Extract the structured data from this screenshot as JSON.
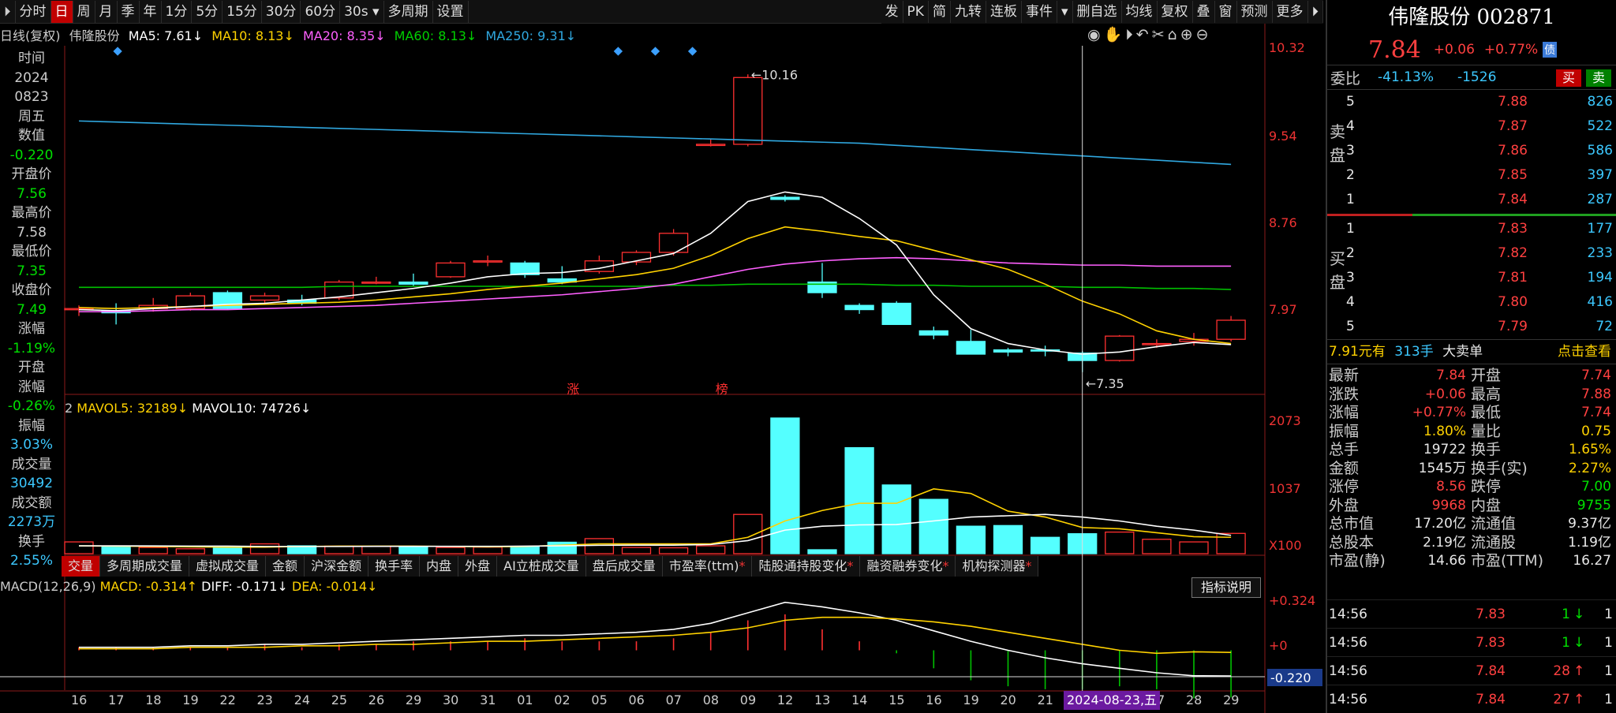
{
  "toolbar": {
    "items": [
      "分时",
      "日",
      "周",
      "月",
      "季",
      "年",
      "1分",
      "5分",
      "15分",
      "30分",
      "60分",
      "30s ▾",
      "多周期",
      "设置"
    ],
    "active_index": 1,
    "right_items": [
      "发",
      "PK",
      "简",
      "九转",
      "连板",
      "事件",
      "▾",
      "删自选",
      "均线",
      "复权",
      "叠",
      "窗",
      "预测",
      "更多",
      "⏵︎"
    ]
  },
  "ma_header": {
    "prefix": "日线(复权)",
    "stock": "伟隆股份",
    "ma5": "MA5: 7.61↓",
    "ma10": "MA10: 8.13↓",
    "ma20": "MA20: 8.35↓",
    "ma60": "MA60: 8.13↓",
    "ma250": "MA250: 9.31↓"
  },
  "left_info": {
    "time_label": "时间",
    "year": "2024",
    "date": "0823",
    "weekday": "周五",
    "value_label": "数值",
    "value": "-0.220",
    "open_label": "开盘价",
    "open": "7.56",
    "high_label": "最高价",
    "high": "7.58",
    "low_label": "最低价",
    "low": "7.35",
    "close_label": "收盘价",
    "close": "7.49",
    "chg_label": "涨幅",
    "chg": "-1.19%",
    "openchg_label1": "开盘",
    "openchg_label2": "涨幅",
    "openchg": "-0.26%",
    "amp_label": "振幅",
    "amp": "3.03%",
    "vol_label": "成交量",
    "vol": "30492",
    "amt_label": "成交额",
    "amt": "2273万",
    "turn_label": "换手",
    "turn": "2.55%"
  },
  "price_axis": [
    "10.32",
    "9.54",
    "8.76",
    "7.97"
  ],
  "annotations": {
    "high_label": "10.16",
    "low_label": "7.35",
    "zhang": "涨",
    "bang": "榜"
  },
  "vol_header": {
    "mavol5": "MAVOL5: 32189↓",
    "mavol10": "MAVOL10: 74726↓",
    "prefix": "2"
  },
  "vol_axis": [
    "2073",
    "1037",
    "X100"
  ],
  "tabs": [
    {
      "label": "交量",
      "dot": false
    },
    {
      "label": "多周期成交量",
      "dot": false
    },
    {
      "label": "虚拟成交量",
      "dot": false
    },
    {
      "label": "金额",
      "dot": false
    },
    {
      "label": "沪深金额",
      "dot": false
    },
    {
      "label": "换手率",
      "dot": false
    },
    {
      "label": "内盘",
      "dot": false
    },
    {
      "label": "外盘",
      "dot": false
    },
    {
      "label": "AI立桩成交量",
      "dot": false
    },
    {
      "label": "盘后成交量",
      "dot": false
    },
    {
      "label": "市盈率(ttm)",
      "dot": true
    },
    {
      "label": "陆股通持股变化",
      "dot": true
    },
    {
      "label": "融资融券变化",
      "dot": true
    },
    {
      "label": "机构探测器",
      "dot": true
    }
  ],
  "macd_header": {
    "name": "MACD(12,26,9)",
    "macd": "MACD: -0.314↑",
    "diff": "DIFF: -0.171↓",
    "dea": "DEA: -0.014↓"
  },
  "index_button": "指标说明",
  "macd_axis": [
    "+0.324",
    "+0",
    "-0.220"
  ],
  "dates": [
    "16",
    "17",
    "18",
    "19",
    "22",
    "23",
    "24",
    "25",
    "26",
    "29",
    "30",
    "31",
    "01",
    "02",
    "05",
    "06",
    "07",
    "08",
    "09",
    "12",
    "13",
    "14",
    "15",
    "16",
    "19",
    "20",
    "21",
    "22",
    "",
    "27",
    "28",
    "29"
  ],
  "selected_date": "2024-08-23,五",
  "colors": {
    "up": "#ff3030",
    "down": "#54ffff",
    "ma5": "#ffffff",
    "ma10": "#ffd200",
    "ma20": "#ff60ff",
    "ma60": "#00c000",
    "ma250": "#30a8e0"
  },
  "chart_data": {
    "type": "candlestick",
    "candles": [
      [
        7.95,
        7.95,
        7.98,
        7.88
      ],
      [
        7.93,
        7.91,
        8.0,
        7.8
      ],
      [
        7.95,
        7.98,
        8.05,
        7.92
      ],
      [
        7.95,
        8.07,
        8.1,
        7.93
      ],
      [
        8.1,
        7.95,
        8.12,
        7.94
      ],
      [
        8.03,
        8.07,
        8.1,
        8.0
      ],
      [
        8.03,
        8.0,
        8.08,
        7.98
      ],
      [
        8.05,
        8.2,
        8.22,
        8.03
      ],
      [
        8.19,
        8.2,
        8.25,
        8.18
      ],
      [
        8.2,
        8.18,
        8.28,
        8.16
      ],
      [
        8.25,
        8.38,
        8.4,
        8.24
      ],
      [
        8.39,
        8.4,
        8.45,
        8.35
      ],
      [
        8.38,
        8.27,
        8.4,
        8.24
      ],
      [
        8.23,
        8.2,
        8.35,
        8.18
      ],
      [
        8.3,
        8.4,
        8.45,
        8.28
      ],
      [
        8.39,
        8.48,
        8.5,
        8.36
      ],
      [
        8.48,
        8.66,
        8.7,
        8.45
      ],
      [
        9.5,
        9.5,
        9.55,
        9.48
      ],
      [
        9.5,
        10.13,
        10.16,
        9.48
      ],
      [
        9.0,
        8.98,
        9.02,
        8.96
      ],
      [
        8.2,
        8.1,
        8.38,
        8.05
      ],
      [
        7.98,
        7.94,
        8.0,
        7.9
      ],
      [
        8.0,
        7.8,
        8.02,
        7.8
      ],
      [
        7.74,
        7.7,
        7.78,
        7.66
      ],
      [
        7.64,
        7.52,
        7.75,
        7.52
      ],
      [
        7.56,
        7.54,
        7.58,
        7.5
      ],
      [
        7.56,
        7.55,
        7.6,
        7.5
      ],
      [
        7.53,
        7.46,
        7.55,
        7.35
      ],
      [
        7.46,
        7.69,
        7.7,
        7.45
      ],
      [
        7.62,
        7.62,
        7.66,
        7.58
      ],
      [
        7.64,
        7.66,
        7.72,
        7.6
      ],
      [
        7.66,
        7.84,
        7.88,
        7.64
      ]
    ],
    "ma5": [
      7.94,
      7.93,
      7.95,
      7.97,
      7.99,
      8.0,
      8.03,
      8.06,
      8.1,
      8.14,
      8.19,
      8.25,
      8.28,
      8.29,
      8.33,
      8.4,
      8.47,
      8.66,
      8.96,
      9.05,
      9.0,
      8.8,
      8.55,
      8.08,
      7.76,
      7.62,
      7.56,
      7.52,
      7.54,
      7.59,
      7.63,
      7.61
    ],
    "ma10": [
      7.96,
      7.95,
      7.96,
      7.97,
      7.98,
      7.99,
      8.0,
      8.01,
      8.03,
      8.06,
      8.09,
      8.13,
      8.16,
      8.19,
      8.23,
      8.27,
      8.33,
      8.45,
      8.61,
      8.72,
      8.68,
      8.63,
      8.59,
      8.5,
      8.41,
      8.32,
      8.18,
      8.02,
      7.9,
      7.74,
      7.66,
      7.62
    ],
    "ma20": [
      7.92,
      7.92,
      7.93,
      7.94,
      7.94,
      7.95,
      7.96,
      7.97,
      7.98,
      8.0,
      8.02,
      8.04,
      8.06,
      8.08,
      8.11,
      8.14,
      8.18,
      8.25,
      8.32,
      8.37,
      8.4,
      8.42,
      8.43,
      8.42,
      8.4,
      8.38,
      8.37,
      8.36,
      8.36,
      8.35,
      8.35,
      8.35
    ],
    "ma60": [
      8.15,
      8.15,
      8.15,
      8.15,
      8.15,
      8.15,
      8.15,
      8.16,
      8.16,
      8.16,
      8.16,
      8.16,
      8.16,
      8.16,
      8.16,
      8.16,
      8.17,
      8.17,
      8.18,
      8.18,
      8.18,
      8.18,
      8.17,
      8.17,
      8.16,
      8.16,
      8.16,
      8.15,
      8.15,
      8.14,
      8.14,
      8.13
    ],
    "ma250": [
      9.72,
      9.71,
      9.7,
      9.69,
      9.68,
      9.67,
      9.66,
      9.65,
      9.64,
      9.63,
      9.62,
      9.61,
      9.6,
      9.59,
      9.58,
      9.57,
      9.56,
      9.55,
      9.54,
      9.53,
      9.52,
      9.51,
      9.49,
      9.47,
      9.45,
      9.43,
      9.41,
      9.39,
      9.37,
      9.35,
      9.33,
      9.31
    ],
    "volume": [
      180,
      110,
      95,
      75,
      95,
      150,
      120,
      115,
      110,
      105,
      95,
      100,
      110,
      175,
      230,
      95,
      90,
      120,
      600,
      2073,
      60,
      1620,
      1050,
      830,
      420,
      430,
      250,
      305,
      330,
      220,
      180,
      310
    ],
    "mavol5": [
      120,
      115,
      110,
      105,
      100,
      100,
      110,
      115,
      115,
      115,
      110,
      105,
      110,
      130,
      150,
      150,
      150,
      150,
      250,
      500,
      660,
      770,
      770,
      990,
      920,
      650,
      560,
      400,
      380,
      320,
      260,
      250
    ],
    "mavol10": [
      120,
      120,
      118,
      116,
      115,
      110,
      110,
      110,
      112,
      112,
      112,
      112,
      115,
      120,
      128,
      130,
      130,
      140,
      200,
      360,
      420,
      440,
      445,
      500,
      560,
      580,
      600,
      560,
      500,
      420,
      360,
      280
    ],
    "diff": [
      0.02,
      0.02,
      0.02,
      0.03,
      0.03,
      0.04,
      0.04,
      0.05,
      0.06,
      0.07,
      0.08,
      0.09,
      0.1,
      0.1,
      0.11,
      0.12,
      0.14,
      0.18,
      0.25,
      0.32,
      0.29,
      0.25,
      0.2,
      0.13,
      0.06,
      0.0,
      -0.05,
      -0.09,
      -0.12,
      -0.15,
      -0.17,
      -0.171
    ],
    "dea": [
      0.01,
      0.01,
      0.01,
      0.02,
      0.02,
      0.02,
      0.03,
      0.03,
      0.04,
      0.04,
      0.05,
      0.06,
      0.06,
      0.07,
      0.08,
      0.09,
      0.1,
      0.12,
      0.15,
      0.2,
      0.22,
      0.22,
      0.21,
      0.19,
      0.16,
      0.12,
      0.08,
      0.04,
      0.0,
      -0.02,
      -0.01,
      -0.014
    ],
    "price_range": [
      7.2,
      10.4
    ],
    "vol_range": [
      0,
      2073
    ],
    "macd_range": [
      -0.25,
      0.35
    ]
  },
  "right_panel": {
    "title": "伟隆股份 002871",
    "price": "7.84",
    "change": "+0.06",
    "change_pct": "+0.77%",
    "badge": "债",
    "weibi_label": "委比",
    "weibi_pct": "-41.13%",
    "weibi_diff": "-1526",
    "buy_btn": "买",
    "sell_btn": "卖",
    "sell_side_label": "卖盘",
    "buy_side_label": "买盘",
    "asks": [
      {
        "lv": "5",
        "price": "7.88",
        "vol": "826"
      },
      {
        "lv": "4",
        "price": "7.87",
        "vol": "522"
      },
      {
        "lv": "3",
        "price": "7.86",
        "vol": "586"
      },
      {
        "lv": "2",
        "price": "7.85",
        "vol": "397"
      },
      {
        "lv": "1",
        "price": "7.84",
        "vol": "287"
      }
    ],
    "bids": [
      {
        "lv": "1",
        "price": "7.83",
        "vol": "177"
      },
      {
        "lv": "2",
        "price": "7.82",
        "vol": "233"
      },
      {
        "lv": "3",
        "price": "7.81",
        "vol": "194"
      },
      {
        "lv": "4",
        "price": "7.80",
        "vol": "416"
      },
      {
        "lv": "5",
        "price": "7.79",
        "vol": "72"
      }
    ],
    "bigorder_price": "7.91元有",
    "bigorder_vol": "313手",
    "bigorder_type": "大卖单",
    "bigorder_link": "点击查看",
    "stats": [
      [
        "最新",
        "7.84",
        "red",
        "开盘",
        "7.74",
        "red"
      ],
      [
        "涨跌",
        "+0.06",
        "red",
        "最高",
        "7.88",
        "red"
      ],
      [
        "涨幅",
        "+0.77%",
        "red",
        "最低",
        "7.74",
        "red"
      ],
      [
        "振幅",
        "1.80%",
        "yel",
        "量比",
        "0.75",
        "yel"
      ],
      [
        "总手",
        "19722",
        "wht",
        "换手",
        "1.65%",
        "yel"
      ],
      [
        "金额",
        "1545万",
        "wht",
        "换手(实)",
        "2.27%",
        "yel"
      ],
      [
        "涨停",
        "8.56",
        "red",
        "跌停",
        "7.00",
        "grn"
      ],
      [
        "外盘",
        "9968",
        "red",
        "内盘",
        "9755",
        "grn"
      ],
      [
        "总市值",
        "17.20亿",
        "wht",
        "流通值",
        "9.37亿",
        "wht"
      ],
      [
        "总股本",
        "2.19亿",
        "wht",
        "流通股",
        "1.19亿",
        "wht"
      ],
      [
        "市盈(静)",
        "14.66",
        "wht",
        "市盈(TTM)",
        "16.27",
        "wht"
      ]
    ],
    "ticks": [
      {
        "time": "14:56",
        "price": "7.83",
        "vol": "1",
        "dir": "↓",
        "num": "1"
      },
      {
        "time": "14:56",
        "price": "7.83",
        "vol": "1",
        "dir": "↓",
        "num": "1"
      },
      {
        "time": "14:56",
        "price": "7.84",
        "vol": "28",
        "dir": "↑",
        "num": "1"
      },
      {
        "time": "14:56",
        "price": "7.84",
        "vol": "27",
        "dir": "↑",
        "num": "1"
      }
    ]
  }
}
